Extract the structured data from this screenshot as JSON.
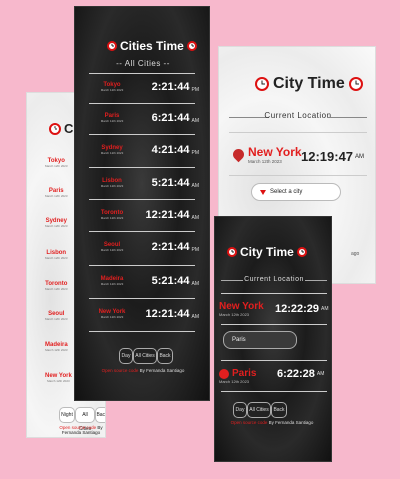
{
  "common": {
    "title": "Cities Time",
    "all_cities": "-- All Cities --",
    "city_time": "City Time",
    "current_location": "Current Location",
    "day_btn": "Day",
    "night_btn": "Night",
    "all_btn": "All Cities",
    "back_btn": "Back",
    "footer_link": "Open source code",
    "footer_by": "By Fernanda Santiago"
  },
  "center": {
    "rows": [
      {
        "city": "Tokyo",
        "date": "March 12th 2023",
        "time": "2:21:44",
        "ampm": "PM"
      },
      {
        "city": "Paris",
        "date": "March 12th 2023",
        "time": "6:21:44",
        "ampm": "AM"
      },
      {
        "city": "Sydney",
        "date": "March 12th 2023",
        "time": "4:21:44",
        "ampm": "PM"
      },
      {
        "city": "Lisbon",
        "date": "March 12th 2023",
        "time": "5:21:44",
        "ampm": "AM"
      },
      {
        "city": "Toronto",
        "date": "March 12th 2023",
        "time": "12:21:44",
        "ampm": "AM"
      },
      {
        "city": "Seoul",
        "date": "March 12th 2023",
        "time": "2:21:44",
        "ampm": "PM"
      },
      {
        "city": "Madeira",
        "date": "March 12th 2023",
        "time": "5:21:44",
        "ampm": "AM"
      },
      {
        "city": "New York",
        "date": "March 12th 2023",
        "time": "12:21:44",
        "ampm": "AM"
      }
    ]
  },
  "left": {
    "title": "Citi",
    "cities": [
      "Tokyo",
      "Paris",
      "Sydney",
      "Lisbon",
      "Toronto",
      "Seoul",
      "Madeira",
      "New York"
    ],
    "date": "March 12th 2023"
  },
  "right_top": {
    "city": "New York",
    "date": "March 12th 2023",
    "time": "12:19:47",
    "ampm": "AM",
    "select_label": "Select a city",
    "edge_text": "ago"
  },
  "right_bottom": {
    "city1": "New York",
    "date1": "March 12th 2023",
    "time1": "12:22:29",
    "ampm1": "AM",
    "input_value": "Paris",
    "city2": "Paris",
    "date2": "March 12th 2023",
    "time2": "6:22:28",
    "ampm2": "AM"
  }
}
